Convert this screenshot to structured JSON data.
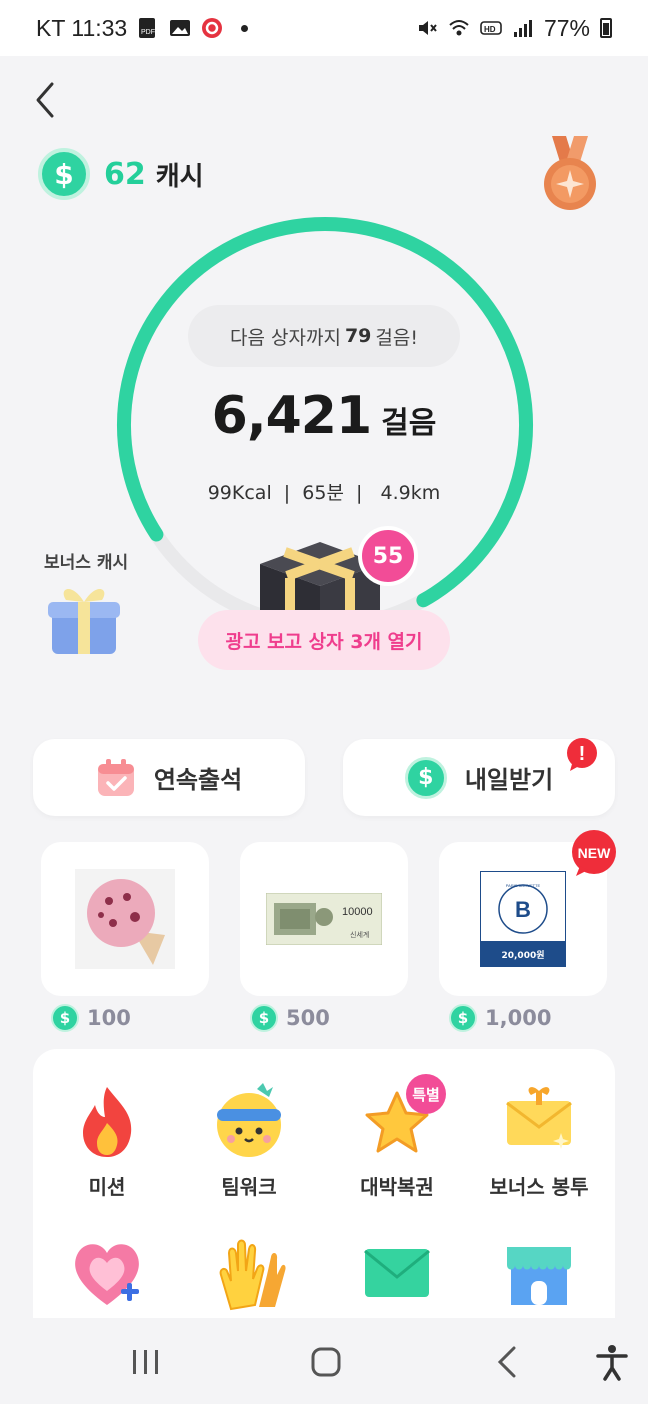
{
  "status_bar": {
    "carrier_time": "KT 11:33",
    "battery": "77%"
  },
  "header": {
    "cash_amount": "62",
    "cash_unit": "캐시"
  },
  "walk": {
    "next_box_prefix": "다음 상자까지",
    "next_box_steps": "79",
    "next_box_suffix": "걸음!",
    "steps": "6,421",
    "steps_unit": "걸음",
    "stats": "99Kcal  |  65분  |   4.9km",
    "progress": 0.76
  },
  "bonus": {
    "label": "보너스 캐시"
  },
  "gift_box": {
    "badge": "55",
    "ad_button": "광고 보고 상자 3개 열기"
  },
  "quick": {
    "attendance": "연속출석",
    "tomorrow": "내일받기",
    "alert": "!"
  },
  "rewards": [
    {
      "price": "100"
    },
    {
      "price": "500",
      "voucher_amount": "10000",
      "voucher_brand": "신세계"
    },
    {
      "price": "1,000",
      "new_label": "NEW",
      "coupon_value": "20,000원",
      "brand_ring": "PARIS BAGUETTE"
    }
  ],
  "menu": {
    "items": [
      {
        "label": "미션",
        "icon": "fire-icon"
      },
      {
        "label": "팀워크",
        "icon": "headband-face-icon"
      },
      {
        "label": "대박복권",
        "icon": "star-icon",
        "badge": "특별"
      },
      {
        "label": "보너스 봉투",
        "icon": "envelope-gift-icon"
      }
    ],
    "row2_icons": [
      "heart-plus-icon",
      "clapping-hands-icon",
      "mail-icon",
      "store-icon"
    ]
  },
  "colors": {
    "accent": "#2fd3a1",
    "pink": "#ef3d8d",
    "background": "#f4f4f6"
  }
}
